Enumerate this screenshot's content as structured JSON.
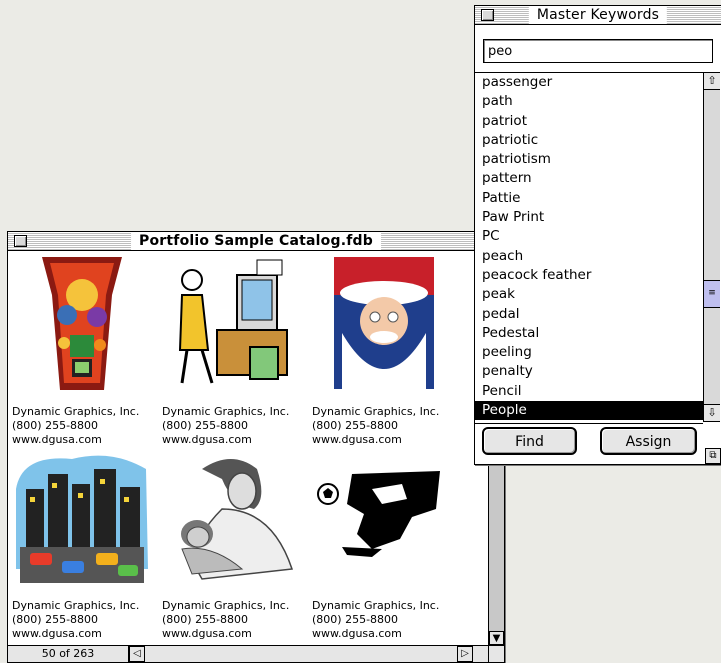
{
  "catalog": {
    "title": "Portfolio Sample Catalog.fdb",
    "counter": "50 of 263",
    "items": [
      {
        "icon": "tiki-collage-icon",
        "line1": "Dynamic Graphics, Inc.",
        "line2": "(800) 255-8800",
        "line3": "www.dgusa.com"
      },
      {
        "icon": "office-worker-icon",
        "line1": "Dynamic Graphics, Inc.",
        "line2": "(800) 255-8800",
        "line3": "www.dgusa.com"
      },
      {
        "icon": "santa-claus-icon",
        "line1": "Dynamic Graphics, Inc.",
        "line2": "(800) 255-8800",
        "line3": "www.dgusa.com"
      },
      {
        "icon": "city-traffic-icon",
        "line1": "Dynamic Graphics, Inc.",
        "line2": "(800) 255-8800",
        "line3": "www.dgusa.com"
      },
      {
        "icon": "mother-child-icon",
        "line1": "Dynamic Graphics, Inc.",
        "line2": "(800) 255-8800",
        "line3": "www.dgusa.com"
      },
      {
        "icon": "soccer-player-icon",
        "line1": "Dynamic Graphics, Inc.",
        "line2": "(800) 255-8800",
        "line3": "www.dgusa.com"
      }
    ]
  },
  "keywords": {
    "title": "Master Keywords",
    "search_value": "peo",
    "items": [
      "passenger",
      "path",
      "patriot",
      "patriotic",
      "patriotism",
      "pattern",
      "Pattie",
      "Paw Print",
      "PC",
      "peach",
      "peacock feather",
      "peak",
      "pedal",
      "Pedestal",
      "peeling",
      "penalty",
      "Pencil",
      "People"
    ],
    "selected": "People",
    "find_label": "Find",
    "assign_label": "Assign"
  }
}
